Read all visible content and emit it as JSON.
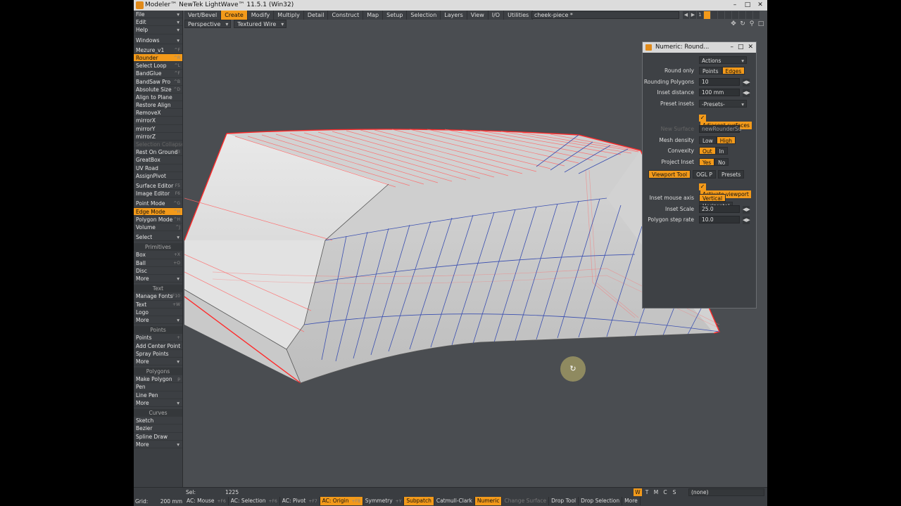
{
  "window": {
    "title": "Modeler™ NewTek LightWave™ 11.5.1 (Win32)",
    "controls": [
      "–",
      "□",
      "✕"
    ]
  },
  "tabs": [
    {
      "label": "Vert/Bevel",
      "active": false
    },
    {
      "label": "Create",
      "active": true
    },
    {
      "label": "Modify",
      "active": false
    },
    {
      "label": "Multiply",
      "active": false
    },
    {
      "label": "Detail",
      "active": false
    },
    {
      "label": "Construct",
      "active": false
    },
    {
      "label": "Map",
      "active": false
    },
    {
      "label": "Setup",
      "active": false
    },
    {
      "label": "Selection",
      "active": false
    },
    {
      "label": "Layers",
      "active": false
    },
    {
      "label": "View",
      "active": false
    },
    {
      "label": "I/O",
      "active": false
    },
    {
      "label": "Utilities",
      "active": false
    }
  ],
  "layer": {
    "name": "cheek-piece *"
  },
  "viewport": {
    "view_mode": "Perspective",
    "render_mode": "Textured Wire"
  },
  "toolbar": {
    "items": [
      {
        "type": "btn",
        "label": "File",
        "drop": true
      },
      {
        "type": "btn",
        "label": "Edit",
        "drop": true
      },
      {
        "type": "btn",
        "label": "Help",
        "drop": true
      },
      {
        "type": "sep"
      },
      {
        "type": "btn",
        "label": "Windows",
        "drop": true
      },
      {
        "type": "sep"
      },
      {
        "type": "btn",
        "label": "Mezure_v1",
        "sc": "^F"
      },
      {
        "type": "btn",
        "label": "Rounder",
        "sc": "^R",
        "active": true
      },
      {
        "type": "btn",
        "label": "Select Loop",
        "sc": "^L"
      },
      {
        "type": "btn",
        "label": "BandGlue",
        "sc": "^F"
      },
      {
        "type": "btn",
        "label": "BandSaw Pro",
        "sc": "^B"
      },
      {
        "type": "btn",
        "label": "Absolute Size",
        "sc": "^D"
      },
      {
        "type": "btn",
        "label": "Align to Plane"
      },
      {
        "type": "btn",
        "label": "Restore Align"
      },
      {
        "type": "btn",
        "label": "RemoveX"
      },
      {
        "type": "btn",
        "label": "mirrorX"
      },
      {
        "type": "btn",
        "label": "mirrorY"
      },
      {
        "type": "btn",
        "label": "mirrorZ"
      },
      {
        "type": "btn",
        "label": "Selection Collapse",
        "dim": true
      },
      {
        "type": "btn",
        "label": "Rest On Ground",
        "sc": "F3"
      },
      {
        "type": "btn",
        "label": "GreatBox"
      },
      {
        "type": "btn",
        "label": "UV Road"
      },
      {
        "type": "btn",
        "label": "AssignPivot"
      },
      {
        "type": "sep"
      },
      {
        "type": "btn",
        "label": "Surface Editor",
        "sc": "F5"
      },
      {
        "type": "btn",
        "label": "Image Editor",
        "sc": "F6"
      },
      {
        "type": "sep"
      },
      {
        "type": "btn",
        "label": "Point Mode",
        "sc": "^G"
      },
      {
        "type": "btn",
        "label": "Edge Mode",
        "sc": "^H",
        "active": true
      },
      {
        "type": "btn",
        "label": "Polygon Mode",
        "sc": "^H"
      },
      {
        "type": "btn",
        "label": "Volume",
        "sc": "^J"
      },
      {
        "type": "sep"
      },
      {
        "type": "btn",
        "label": "Select",
        "drop": true
      },
      {
        "type": "sep"
      },
      {
        "type": "head",
        "label": "Primitives"
      },
      {
        "type": "btn",
        "label": "Box",
        "sc": "+X"
      },
      {
        "type": "btn",
        "label": "Ball",
        "sc": "+O"
      },
      {
        "type": "btn",
        "label": "Disc"
      },
      {
        "type": "btn",
        "label": "More",
        "drop": true
      },
      {
        "type": "sep"
      },
      {
        "type": "head",
        "label": "Text"
      },
      {
        "type": "btn",
        "label": "Manage Fonts",
        "sc": "F10"
      },
      {
        "type": "btn",
        "label": "Text",
        "sc": "+W"
      },
      {
        "type": "btn",
        "label": "Logo"
      },
      {
        "type": "btn",
        "label": "More",
        "drop": true
      },
      {
        "type": "sep"
      },
      {
        "type": "head",
        "label": "Points"
      },
      {
        "type": "btn",
        "label": "Points",
        "sc": "+"
      },
      {
        "type": "btn",
        "label": "Add Center Point"
      },
      {
        "type": "btn",
        "label": "Spray Points"
      },
      {
        "type": "btn",
        "label": "More",
        "drop": true
      },
      {
        "type": "sep"
      },
      {
        "type": "head",
        "label": "Polygons"
      },
      {
        "type": "btn",
        "label": "Make Polygon",
        "sc": "p"
      },
      {
        "type": "btn",
        "label": "Pen"
      },
      {
        "type": "btn",
        "label": "Line Pen"
      },
      {
        "type": "btn",
        "label": "More",
        "drop": true
      },
      {
        "type": "sep"
      },
      {
        "type": "head",
        "label": "Curves"
      },
      {
        "type": "btn",
        "label": "Sketch"
      },
      {
        "type": "btn",
        "label": "Bezier"
      },
      {
        "type": "btn",
        "label": "Spline Draw"
      },
      {
        "type": "btn",
        "label": "More",
        "drop": true
      }
    ]
  },
  "panel": {
    "title": "Numeric: Round...",
    "controls": [
      "–",
      "□",
      "✕"
    ],
    "actions_label": "Actions",
    "round_only": {
      "label": "Round only",
      "options": [
        "Points",
        "Edges"
      ],
      "selected": 1
    },
    "rounding_polygons": {
      "label": "Rounding Polygons",
      "value": "10"
    },
    "inset_distance": {
      "label": "Inset distance",
      "value": "100 mm"
    },
    "preset_insets": {
      "label": "Preset insets",
      "value": "-Presets-"
    },
    "adjacent_surfaces": {
      "label": "Adjacent surfaces",
      "checked": true
    },
    "new_surface": {
      "label": "New Surface",
      "value": "newRounderSu"
    },
    "mesh_density": {
      "label": "Mesh density",
      "options": [
        "Low",
        "High"
      ],
      "selected": 1
    },
    "convexity": {
      "label": "Convexity",
      "options": [
        "Out",
        "In"
      ],
      "selected": 0
    },
    "project_inset": {
      "label": "Project Inset",
      "options": [
        "Yes",
        "No"
      ],
      "selected": 0
    },
    "subtabs": [
      {
        "label": "Viewport Tool",
        "active": true
      },
      {
        "label": "OGL P",
        "active": false
      },
      {
        "label": "Presets",
        "active": false
      }
    ],
    "activate_viewport": {
      "label": "Activate viewport",
      "checked": true
    },
    "inset_mouse_axis": {
      "label": "Inset mouse axis",
      "options": [
        "Vertical",
        "Horizontal"
      ],
      "selected": 0
    },
    "inset_scale": {
      "label": "Inset Scale",
      "value": "25.0"
    },
    "polygon_step_rate": {
      "label": "Polygon step rate",
      "value": "10.0"
    }
  },
  "status": {
    "sel_label": "Sel:",
    "sel_value": "1225",
    "wtm": [
      {
        "label": "W",
        "on": true
      },
      {
        "label": "T",
        "on": false
      },
      {
        "label": "M",
        "on": false
      },
      {
        "label": "C",
        "on": false
      },
      {
        "label": "S",
        "on": false
      }
    ],
    "none_label": "(none)",
    "grid_label": "Grid:",
    "grid_value": "200 mm",
    "buttons": [
      {
        "label": "AC: Mouse",
        "key": "+F6",
        "on": false
      },
      {
        "label": "AC: Selection",
        "key": "+F6",
        "on": false
      },
      {
        "label": "AC: Pivot",
        "key": "+F7",
        "on": false
      },
      {
        "label": "AC: Origin",
        "key": "+F8",
        "on": true
      },
      {
        "label": "Symmetry",
        "key": "+Y",
        "on": false
      },
      {
        "label": "Subpatch",
        "key": "",
        "on": true
      },
      {
        "label": "Catmull-Clark",
        "key": "",
        "on": false
      },
      {
        "label": "Numeric",
        "key": "",
        "on": true
      },
      {
        "label": "Change Surface",
        "key": "",
        "on": false,
        "dim": true
      },
      {
        "label": "Drop Tool",
        "key": "",
        "on": false
      },
      {
        "label": "Drop Selection",
        "key": "",
        "on": false
      },
      {
        "label": "More",
        "key": "",
        "on": false
      }
    ]
  }
}
